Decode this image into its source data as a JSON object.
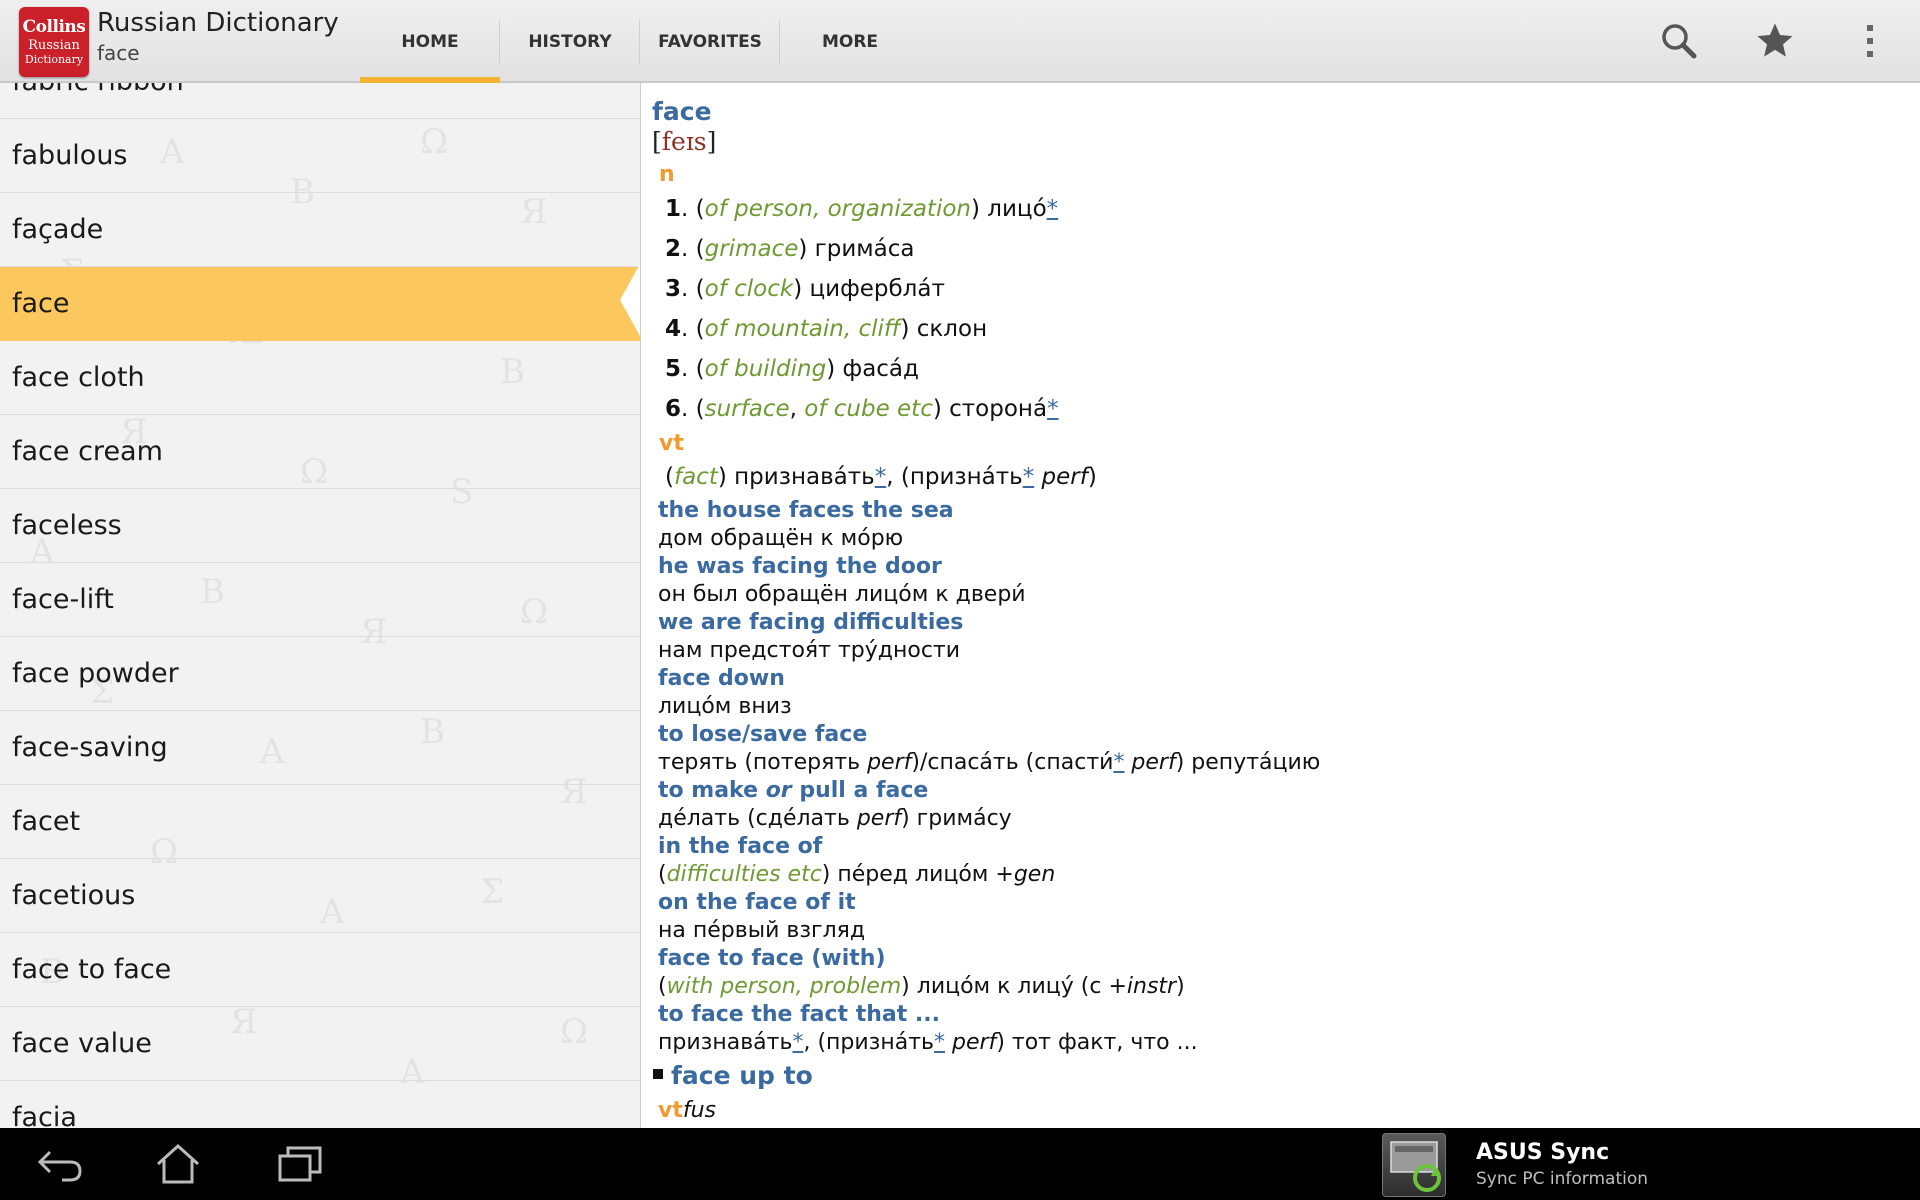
{
  "app": {
    "logo_line1": "Collins",
    "logo_line2": "Russian",
    "logo_line3": "Dictionary",
    "title": "Russian Dictionary",
    "subtitle": "face"
  },
  "tabs": [
    {
      "label": "HOME",
      "active": true
    },
    {
      "label": "HISTORY",
      "active": false
    },
    {
      "label": "FAVORITES",
      "active": false
    },
    {
      "label": "MORE",
      "active": false
    }
  ],
  "toolbar_icons": [
    "search-icon",
    "star-icon",
    "overflow-menu-icon"
  ],
  "wordlist": {
    "partial_top": "fabric ribbon",
    "items": [
      "fabulous",
      "façade",
      "face",
      "face cloth",
      "face cream",
      "faceless",
      "face-lift",
      "face powder",
      "face-saving",
      "facet",
      "facetious",
      "face to face",
      "face value"
    ],
    "partial_bottom": "facia",
    "selected": "face"
  },
  "entry": {
    "headword": "face",
    "pron_open": "[",
    "pron_ipa": "feɪs",
    "pron_close": "]",
    "pos_noun": "n",
    "senses": [
      {
        "num": "1",
        "gloss": "of person, organization",
        "ru": "лицó",
        "star": "*"
      },
      {
        "num": "2",
        "gloss": "grimace",
        "ru": "грима́са",
        "star": ""
      },
      {
        "num": "3",
        "gloss": "of clock",
        "ru": "циферблáт",
        "star": ""
      },
      {
        "num": "4",
        "gloss": "of mountain, cliff",
        "ru": "склон",
        "star": ""
      },
      {
        "num": "5",
        "gloss": "of building",
        "ru": "фасáд",
        "star": ""
      },
      {
        "num": "6",
        "gloss": "surface",
        "gloss2": "of cube etc",
        "ru": "сторонá",
        "star": "*"
      }
    ],
    "pos_verb": "vt",
    "verb_sense": {
      "gloss": "fact",
      "ru1": "признавáть",
      "star1": "*",
      "ru2": "признáть",
      "star2": "*",
      "perf": "perf"
    },
    "examples": [
      {
        "en": "the house faces the sea",
        "ru": "дом обращён к мóрю"
      },
      {
        "en": "he was facing the door",
        "ru": "он был обращён лицóм к двери́"
      },
      {
        "en": "we are facing difficulties",
        "ru": "нам предстоя́т трýдности"
      },
      {
        "en": "face down",
        "ru": "лицóм вниз"
      },
      {
        "en": "to lose/save face",
        "ru_a": "терять (потерять ",
        "ru_perf1": "perf",
        "ru_b": ")/спасáть (спасти́",
        "ru_star": "*",
        "ru_perf2": " perf",
        "ru_c": ") репутáцию"
      },
      {
        "en_a": "to make ",
        "en_or": "or",
        "en_b": " pull a face",
        "ru_a": "дéлать (сдéлать ",
        "ru_perf": "perf",
        "ru_b": ") гримáсу"
      },
      {
        "en": "in the face of",
        "ru_gloss": "difficulties etc",
        "ru": " пéред лицóм ",
        "ru_gen": "+gen"
      },
      {
        "en": "on the face of it",
        "ru": "на пéрвый взгляд"
      },
      {
        "en": "face to face (with)",
        "ru_gloss": "with person, problem",
        "ru": " лицóм к лицý (с ",
        "ru_instr": "+instr",
        "ru_end": ")"
      },
      {
        "en": "to face the fact that ...",
        "ru_a": "признавáть",
        "ru_star1": "*",
        "ru_b": ", (признáть",
        "ru_star2": "*",
        "ru_perf": " perf",
        "ru_c": ") тот факт, что ..."
      }
    ],
    "sub_headword": "face up to",
    "sub_pos": "vt",
    "sub_pos_suffix": "fus"
  },
  "navbar": {
    "buttons": [
      "back-icon",
      "home-icon",
      "recent-apps-icon"
    ],
    "notification_title": "ASUS Sync",
    "notification_subtitle": "Sync PC information"
  }
}
